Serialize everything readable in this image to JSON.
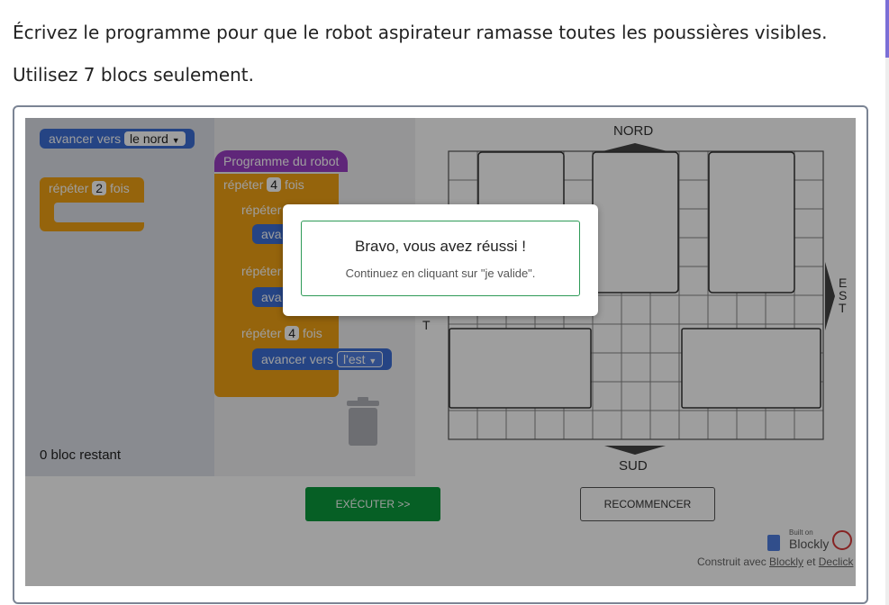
{
  "instructions": {
    "line1": "Écrivez le programme pour que le robot aspirateur ramasse toutes les poussières visibles.",
    "line2": "Utilisez 7 blocs seulement."
  },
  "toolbox": {
    "move_label": "avancer vers",
    "move_option": "le nord",
    "repeat_label": "répéter",
    "repeat_count": "2",
    "repeat_suffix": "fois",
    "blocks_remaining": "0 bloc restant"
  },
  "program": {
    "header": "Programme du robot",
    "outer_repeat_label": "répéter",
    "outer_repeat_count": "4",
    "outer_repeat_suffix": "fois",
    "inner1_label": "répéter",
    "inner1_move_label": "ava",
    "inner2_label": "répéter",
    "inner2_move_label": "ava",
    "inner3_label": "répéter",
    "inner3_count": "4",
    "inner3_suffix": "fois",
    "inner3_move_label": "avancer vers",
    "inner3_move_option": "l'est"
  },
  "grid": {
    "north": "NORD",
    "south": "SUD",
    "east": "EST",
    "west_partial": "T"
  },
  "buttons": {
    "execute": "EXÉCUTER >>",
    "reset": "RECOMMENCER"
  },
  "footer": {
    "built_on": "Built on",
    "blockly_logo": "Blockly",
    "credits_prefix": "Construit avec",
    "credits_blockly": "Blockly",
    "credits_and": "et",
    "credits_declick": "Declick"
  },
  "modal": {
    "title": "Bravo, vous avez réussi !",
    "message": "Continuez en cliquant sur \"je valide\"."
  },
  "colors": {
    "move_block": "#3d6fd6",
    "repeat_block": "#f1a214",
    "program_block": "#9a3ec4",
    "execute_button": "#0a9a3c",
    "modal_border": "#2e9a57",
    "scroll_accent": "#7b6fd6"
  },
  "icons": [
    "dropdown-arrow-icon",
    "trash-icon",
    "bed-icon",
    "rug-icon",
    "slippers-icon",
    "north-arrow-icon",
    "south-arrow-icon",
    "east-arrow-icon",
    "blockly-logo-icon"
  ]
}
